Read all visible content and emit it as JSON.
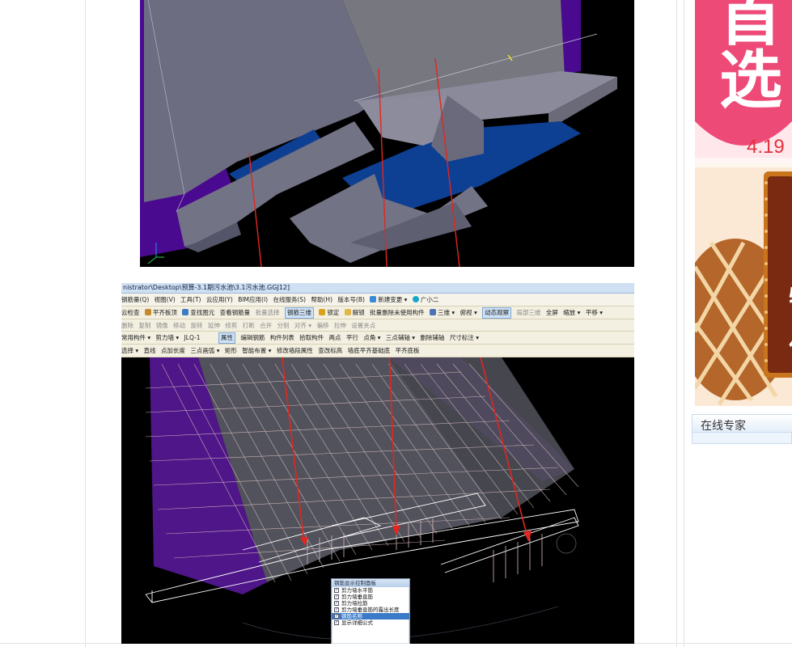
{
  "screenshot": {
    "title_bar": "nistrator\\Desktop\\预算-3.1期污水池\\3.1污水池.GGJ12]",
    "menu": [
      "钢筋量(Q)",
      "视图(V)",
      "工具(T)",
      "云应用(Y)",
      "BIM应用(I)",
      "在线服务(S)",
      "帮助(H)",
      "版本号(B)",
      "新建变更 ▾",
      "广小二"
    ],
    "toolbar1": [
      "云检查",
      "平齐板顶",
      "查找图元",
      "查看钢筋量",
      "批量选择",
      "钢筋三维",
      "锁定",
      "解锁",
      "批量删除未使用构件",
      "三维 ▾",
      "俯视 ▾",
      "动态观察",
      "局部三维",
      "全屏",
      "缩放 ▾",
      "平移 ▾"
    ],
    "toolbar1_active": "钢筋三维",
    "toolbar1_active2": "动态观察",
    "toolbar2": [
      "删除",
      "复制",
      "镜像",
      "移动",
      "旋转",
      "延伸",
      "修剪",
      "打断",
      "合并",
      "分割",
      "对齐 ▾",
      "偏移",
      "拉伸",
      "设置夹点"
    ],
    "toolbar3": [
      "常用构件 ▾",
      "剪力墙 ▾",
      "JLQ-1",
      "属性",
      "编辑钢筋",
      "构件列表",
      "拾取构件",
      "两点",
      "平行",
      "点角 ▾",
      "三点辅轴 ▾",
      "删除辅轴",
      "尺寸标注 ▾"
    ],
    "toolbar3_active": "属性",
    "toolbar4": [
      "选择 ▾",
      "直线",
      "点加长度",
      "三点画弧 ▾",
      "矩形",
      "智能布置 ▾",
      "修改墙段属性",
      "查改标高",
      "墙底平齐基础底",
      "平齐底板"
    ],
    "rebar_panel": {
      "title": "钢筋显示控制面板",
      "items": [
        "剪力墙水平筋",
        "剪力墙垂直筋",
        "剪力墙拉筋",
        "剪力墙垂直筋的露出长度",
        "钢筋名称",
        "显示详细公式"
      ],
      "selected_index": 4
    }
  },
  "ad": {
    "big_char_1": "首",
    "big_char_2": "选",
    "date": "4.19",
    "side_letters": [
      "日",
      "日",
      "特",
      "信"
    ]
  },
  "sidebar": {
    "expert_label": "在线专家"
  },
  "colors": {
    "purple_face": "#4a0a8f",
    "gray_face": "#6d6d82",
    "blue_face": "#0d3f93",
    "arrow_red": "#e3261f",
    "ad_pink": "#ee4a78",
    "ad_brown": "#b5662a"
  }
}
